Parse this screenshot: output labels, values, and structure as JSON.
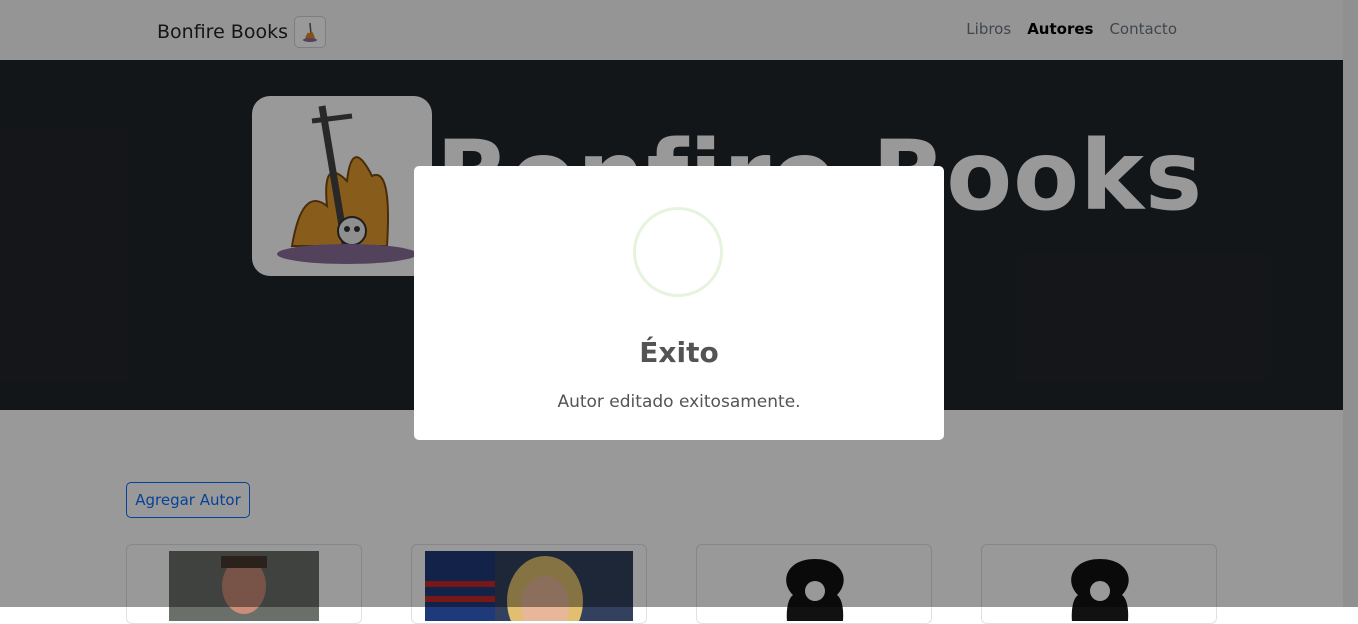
{
  "navbar": {
    "brand": "Bonfire Books",
    "links": [
      {
        "label": "Libros",
        "active": false
      },
      {
        "label": "Autores",
        "active": true
      },
      {
        "label": "Contacto",
        "active": false
      }
    ]
  },
  "hero": {
    "title": "Bonfire Books"
  },
  "content": {
    "add_button": "Agregar Autor"
  },
  "modal": {
    "title": "Éxito",
    "message": "Autor editado exitosamente.",
    "icon": "success-icon"
  },
  "colors": {
    "primary": "#0d6efd",
    "hero_bg": "#212529",
    "success_ring": "#e6f4dd"
  }
}
